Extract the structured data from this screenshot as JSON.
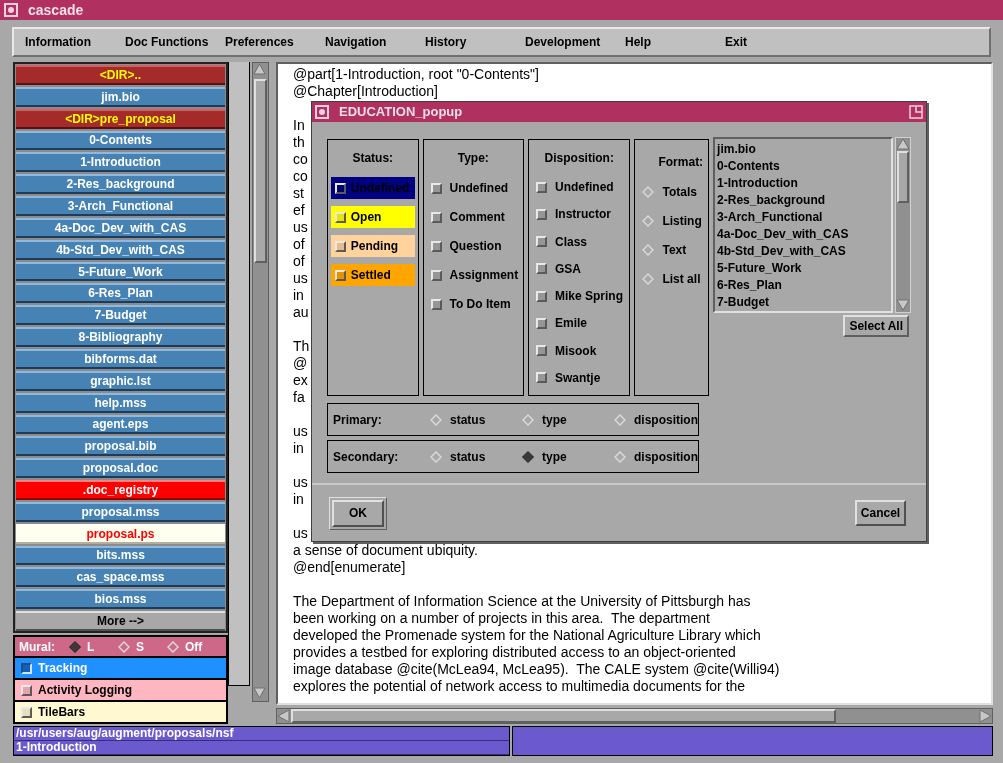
{
  "window": {
    "title": "cascade"
  },
  "menu": [
    "Information",
    "Doc Functions",
    "Preferences",
    "Navigation",
    "History",
    "Development",
    "Help",
    "Exit"
  ],
  "sidebar": {
    "items": [
      {
        "label": "<DIR>..",
        "kind": "dir"
      },
      {
        "label": "jim.bio",
        "kind": "file"
      },
      {
        "label": "<DIR>pre_proposal",
        "kind": "dir"
      },
      {
        "label": "0-Contents",
        "kind": "file"
      },
      {
        "label": "1-Introduction",
        "kind": "file"
      },
      {
        "label": "2-Res_background",
        "kind": "file"
      },
      {
        "label": "3-Arch_Functional",
        "kind": "file"
      },
      {
        "label": "4a-Doc_Dev_with_CAS",
        "kind": "file"
      },
      {
        "label": "4b-Std_Dev_with_CAS",
        "kind": "file"
      },
      {
        "label": "5-Future_Work",
        "kind": "file"
      },
      {
        "label": "6-Res_Plan",
        "kind": "file"
      },
      {
        "label": "7-Budget",
        "kind": "file"
      },
      {
        "label": "8-Bibliography",
        "kind": "file"
      },
      {
        "label": "bibforms.dat",
        "kind": "file"
      },
      {
        "label": "graphic.lst",
        "kind": "file"
      },
      {
        "label": "help.mss",
        "kind": "file"
      },
      {
        "label": "agent.eps",
        "kind": "file"
      },
      {
        "label": "proposal.bib",
        "kind": "file"
      },
      {
        "label": "proposal.doc",
        "kind": "file"
      },
      {
        "label": ".doc_registry",
        "kind": "alert"
      },
      {
        "label": "proposal.mss",
        "kind": "file"
      },
      {
        "label": "proposal.ps",
        "kind": "current"
      },
      {
        "label": "bits.mss",
        "kind": "file"
      },
      {
        "label": "cas_space.mss",
        "kind": "file"
      },
      {
        "label": "bios.mss",
        "kind": "file"
      },
      {
        "label": "More -->",
        "kind": "more"
      }
    ]
  },
  "mural": {
    "label": "Mural:",
    "color": "#cd6889",
    "options": [
      {
        "label": "L",
        "selected": true
      },
      {
        "label": "S",
        "selected": false
      },
      {
        "label": "Off",
        "selected": false
      }
    ]
  },
  "toggles": [
    {
      "label": "Tracking",
      "checked": true,
      "color": "#1e90ff"
    },
    {
      "label": "Activity Logging",
      "checked": false,
      "color": "#ffb6c1"
    },
    {
      "label": "TileBars",
      "checked": false,
      "color": "#fff8d0"
    }
  ],
  "document": {
    "paragraphs": [
      [
        "@part[1-Introduction, root \"0-Contents\"]",
        "@Chapter[Introduction]"
      ],
      [
        "In",
        "th",
        "co",
        "co",
        "st",
        "ef",
        "us",
        "of",
        "of",
        "us",
        "in",
        "au"
      ],
      [
        "Th",
        "@",
        "ex",
        "fa"
      ],
      [
        "us",
        "in"
      ],
      [
        "us",
        "in"
      ],
      [
        "us",
        "a sense of document ubiquity.",
        "@end[enumerate]"
      ],
      [
        "The Department of Information Science at the University of Pittsburgh has",
        "been working on a number of projects in this area.  The department",
        "developed the Promenade system for the National Agriculture Library which",
        "provides a testbed for exploring distributed access to an object-oriented",
        "image database @cite(McLea94, McLea95).  The CALE system @cite(Willi94)",
        "explores the potential of network access to multimedia documents for the"
      ]
    ]
  },
  "status_bar": {
    "path": "/usr/users/aug/augment/proposals/nsf",
    "section": "1-Introduction"
  },
  "dialog": {
    "title": "EDUCATION_popup",
    "status": {
      "heading": "Status:",
      "items": [
        {
          "label": "Undefined",
          "checked": false,
          "color": "#000080"
        },
        {
          "label": "Open",
          "checked": false,
          "color": "#ffff00"
        },
        {
          "label": "Pending",
          "checked": false,
          "color": "#ffd39b"
        },
        {
          "label": "Settled",
          "checked": false,
          "color": "#ffa500"
        }
      ]
    },
    "type": {
      "heading": "Type:",
      "items": [
        {
          "label": "Undefined",
          "checked": false
        },
        {
          "label": "Comment",
          "checked": false
        },
        {
          "label": "Question",
          "checked": false
        },
        {
          "label": "Assignment",
          "checked": false
        },
        {
          "label": "To Do Item",
          "checked": false
        }
      ]
    },
    "disposition": {
      "heading": "Disposition:",
      "items": [
        {
          "label": "Undefined",
          "checked": false
        },
        {
          "label": "Instructor",
          "checked": false
        },
        {
          "label": "Class",
          "checked": false
        },
        {
          "label": "GSA",
          "checked": false
        },
        {
          "label": "Mike Spring",
          "checked": false
        },
        {
          "label": "Emile",
          "checked": false
        },
        {
          "label": "Misook",
          "checked": false
        },
        {
          "label": "Swantje",
          "checked": false
        }
      ]
    },
    "format": {
      "heading": "Format:",
      "options": [
        {
          "label": "Totals",
          "selected": false
        },
        {
          "label": "Listing",
          "selected": false
        },
        {
          "label": "Text",
          "selected": false
        },
        {
          "label": "List all",
          "selected": false
        }
      ]
    },
    "documents": [
      "jim.bio",
      "0-Contents",
      "1-Introduction",
      "2-Res_background",
      "3-Arch_Functional",
      "4a-Doc_Dev_with_CAS",
      "4b-Std_Dev_with_CAS",
      "5-Future_Work",
      "6-Res_Plan",
      "7-Budget"
    ],
    "select_all": "Select All",
    "primary": {
      "label": "Primary:",
      "options": [
        {
          "label": "status",
          "selected": false
        },
        {
          "label": "type",
          "selected": false
        },
        {
          "label": "disposition",
          "selected": false
        }
      ]
    },
    "secondary": {
      "label": "Secondary:",
      "options": [
        {
          "label": "status",
          "selected": false
        },
        {
          "label": "type",
          "selected": true
        },
        {
          "label": "disposition",
          "selected": false
        }
      ]
    },
    "ok": "OK",
    "cancel": "Cancel"
  }
}
